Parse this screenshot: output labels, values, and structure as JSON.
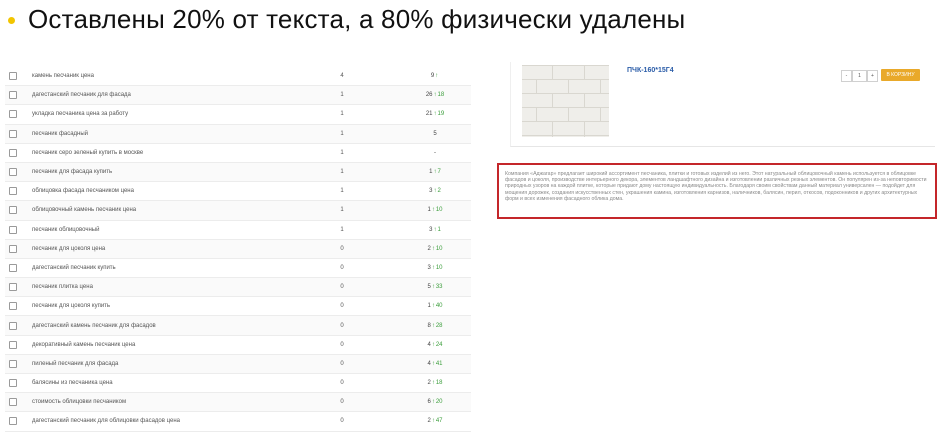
{
  "slide": {
    "title": "Оставлены 20% от текста, а 80% физически удалены"
  },
  "keywords": [
    {
      "query": "камень песчаник цена",
      "count": "4",
      "pos": "9",
      "arrow": true,
      "change": ""
    },
    {
      "query": "дагестанский песчаник для фасада",
      "count": "1",
      "pos": "26",
      "arrow": true,
      "change": "18"
    },
    {
      "query": "укладка песчаника цена за работу",
      "count": "1",
      "pos": "21",
      "arrow": true,
      "change": "19"
    },
    {
      "query": "песчаник фасадный",
      "count": "1",
      "pos": "5",
      "arrow": false,
      "change": ""
    },
    {
      "query": "песчаник серо зеленый купить в москве",
      "count": "1",
      "pos": "-",
      "arrow": false,
      "change": ""
    },
    {
      "query": "песчаник для фасада купить",
      "count": "1",
      "pos": "1",
      "arrow": true,
      "change": "7"
    },
    {
      "query": "облицовка фасада песчаником цена",
      "count": "1",
      "pos": "3",
      "arrow": true,
      "change": "2"
    },
    {
      "query": "облицовочный камень песчаник цена",
      "count": "1",
      "pos": "1",
      "arrow": true,
      "change": "10"
    },
    {
      "query": "песчаник облицовочный",
      "count": "1",
      "pos": "3",
      "arrow": true,
      "change": "1"
    },
    {
      "query": "песчаник для цоколя цена",
      "count": "0",
      "pos": "2",
      "arrow": true,
      "change": "10"
    },
    {
      "query": "дагестанский песчаник купить",
      "count": "0",
      "pos": "3",
      "arrow": true,
      "change": "10"
    },
    {
      "query": "песчаник плитка цена",
      "count": "0",
      "pos": "5",
      "arrow": true,
      "change": "33"
    },
    {
      "query": "песчаник для цоколя купить",
      "count": "0",
      "pos": "1",
      "arrow": true,
      "change": "40"
    },
    {
      "query": "дагестанский камень песчаник для фасадов",
      "count": "0",
      "pos": "8",
      "arrow": true,
      "change": "28"
    },
    {
      "query": "декоративный камень песчаник цена",
      "count": "0",
      "pos": "4",
      "arrow": true,
      "change": "24"
    },
    {
      "query": "пиленый песчаник для фасада",
      "count": "0",
      "pos": "4",
      "arrow": true,
      "change": "41"
    },
    {
      "query": "балясины из песчаника цена",
      "count": "0",
      "pos": "2",
      "arrow": true,
      "change": "18"
    },
    {
      "query": "стоимость облицовки песчаником",
      "count": "0",
      "pos": "6",
      "arrow": true,
      "change": "20"
    },
    {
      "query": "дагестанский песчаник для облицовки фасадов цена",
      "count": "0",
      "pos": "2",
      "arrow": true,
      "change": "47"
    }
  ],
  "product": {
    "name": "ПЧК-160*15Г4",
    "qty_minus": "-",
    "qty_value": "1",
    "qty_plus": "+",
    "cart_label": "В КОРЗИНУ"
  },
  "description": "Компания «Аджагар» предлагает широкий ассортимент песчаника, плитки и готовых изделий из него. Этот натуральный облицовочный камень используется в облицовке фасадов и цоколя, производстве интерьерного декора, элементов ландшафтного дизайна и изготовлении различных резных элементов. Он популярен из-за неповторимости природных узоров на каждой плитке, которые придают дому настоящую индивидуальность. Благодаря своим свойствам данный материал универсален — подойдет для мощения дорожек, создания искусственных стен, украшения камина, изготовления карнизов, наличников, балясин, перил, откосов, подоконников и других архитектурных форм и всех изменения фасадного облика дома.",
  "colors": {
    "bullet": "#f2c500",
    "highlight_border": "#c4262a",
    "up_arrow": "#3a9d3a",
    "cart_button": "#e9a92a"
  }
}
